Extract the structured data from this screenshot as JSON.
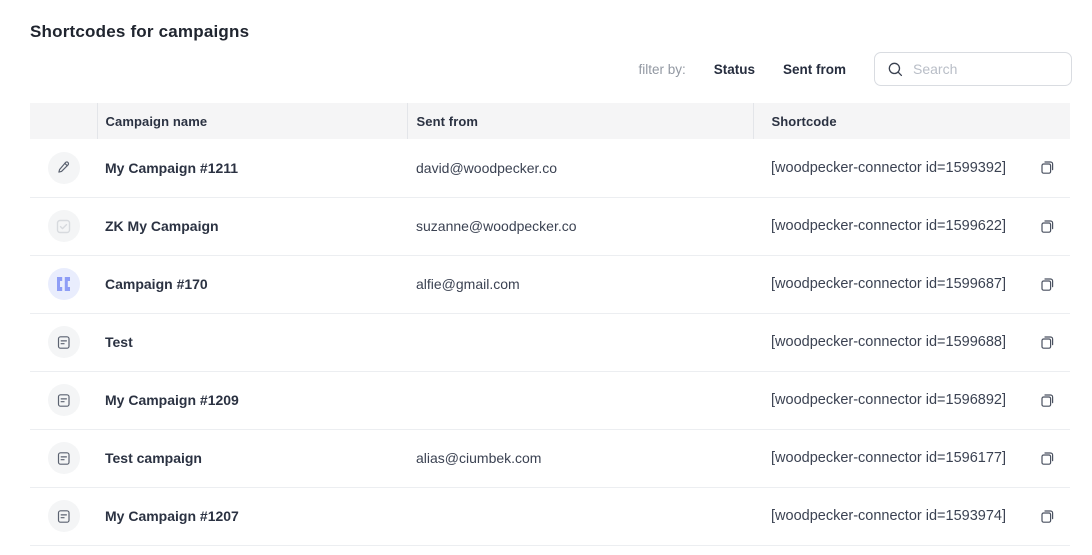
{
  "page": {
    "title": "Shortcodes for campaigns"
  },
  "filter_bar": {
    "label": "filter by:",
    "filters": [
      {
        "label": "Status"
      },
      {
        "label": "Sent from"
      }
    ]
  },
  "search": {
    "placeholder": "Search",
    "value": ""
  },
  "table": {
    "columns": [
      {
        "label": ""
      },
      {
        "label": "Campaign name"
      },
      {
        "label": "Sent from"
      },
      {
        "label": "Shortcode"
      }
    ],
    "rows": [
      {
        "status_icon": "pencil",
        "name": "My Campaign #1211",
        "sent_from": "david@woodpecker.co",
        "shortcode": "[woodpecker-connector id=1599392]"
      },
      {
        "status_icon": "checkbox",
        "name": "ZK My Campaign",
        "sent_from": "suzanne@woodpecker.co",
        "shortcode": "[woodpecker-connector id=1599622]"
      },
      {
        "status_icon": "pause",
        "name": "Campaign #170",
        "sent_from": "alfie@gmail.com",
        "shortcode": "[woodpecker-connector id=1599687]"
      },
      {
        "status_icon": "draft",
        "name": "Test",
        "sent_from": "",
        "shortcode": "[woodpecker-connector id=1599688]"
      },
      {
        "status_icon": "draft",
        "name": "My Campaign #1209",
        "sent_from": "",
        "shortcode": "[woodpecker-connector id=1596892]"
      },
      {
        "status_icon": "draft",
        "name": "Test campaign",
        "sent_from": "alias@ciumbek.com",
        "shortcode": "[woodpecker-connector id=1596177]"
      },
      {
        "status_icon": "draft",
        "name": "My Campaign #1207",
        "sent_from": "",
        "shortcode": "[woodpecker-connector id=1593974]"
      }
    ]
  },
  "colors": {
    "accent_periwinkle": "#8e9df6",
    "badge_lavender_bg": "#e9edfd",
    "badge_gray_bg": "#f4f5f6",
    "header_bg": "#f5f5f6",
    "text_dark": "#2b3242",
    "text_muted": "#9298a2",
    "border": "#eceef1"
  }
}
